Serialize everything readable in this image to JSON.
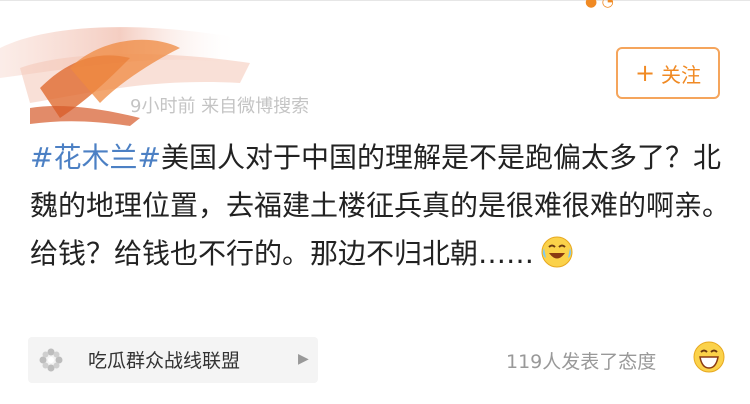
{
  "header": {
    "meta_text": "9小时前 来自微博搜索"
  },
  "follow_button": {
    "label": "关注"
  },
  "post": {
    "hashtag": "#花木兰#",
    "body": "美国人对于中国的理解是不是跑偏太多了？北魏的地理位置，去福建土楼征兵真的是很难很难的啊亲。给钱？给钱也不行的。那边不归北朝……"
  },
  "source": {
    "label": "吃瓜群众战线联盟"
  },
  "reactions": {
    "text": "119人发表了态度"
  },
  "icons": {
    "cry_laugh": "face-with-tears-of-joy-icon",
    "grin": "grinning-face-icon",
    "flower": "flower-icon"
  },
  "colors": {
    "accent": "#f08a24",
    "hashtag": "#4c80c4"
  }
}
